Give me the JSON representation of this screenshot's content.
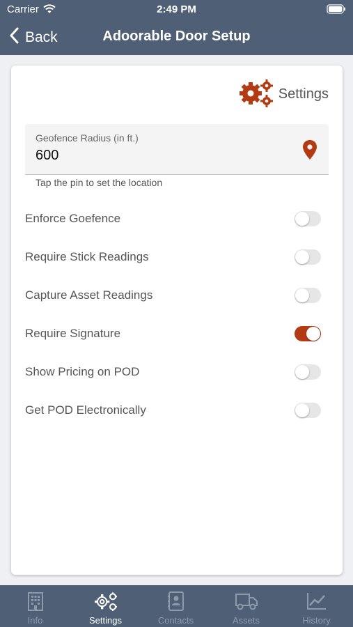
{
  "status_bar": {
    "carrier": "Carrier",
    "time": "2:49 PM"
  },
  "nav": {
    "back_label": "Back",
    "title": "Adoorable Door Setup"
  },
  "settings": {
    "header_label": "Settings",
    "geofence": {
      "label": "Geofence Radius (in ft.)",
      "value": "600",
      "helper": "Tap the pin to set the location"
    },
    "toggles": [
      {
        "label": "Enforce Goefence",
        "on": false
      },
      {
        "label": "Require Stick Readings",
        "on": false
      },
      {
        "label": "Capture Asset Readings",
        "on": false
      },
      {
        "label": "Require Signature",
        "on": true
      },
      {
        "label": "Show Pricing on POD",
        "on": false
      },
      {
        "label": "Get POD Electronically",
        "on": false
      }
    ]
  },
  "tabs": [
    {
      "label": "Info",
      "icon": "building-icon",
      "active": false
    },
    {
      "label": "Settings",
      "icon": "gears-icon",
      "active": true
    },
    {
      "label": "Contacts",
      "icon": "contact-book-icon",
      "active": false
    },
    {
      "label": "Assets",
      "icon": "truck-icon",
      "active": false
    },
    {
      "label": "History",
      "icon": "chart-icon",
      "active": false
    }
  ],
  "colors": {
    "header": "#4f5f75",
    "accent": "#b33a12"
  }
}
